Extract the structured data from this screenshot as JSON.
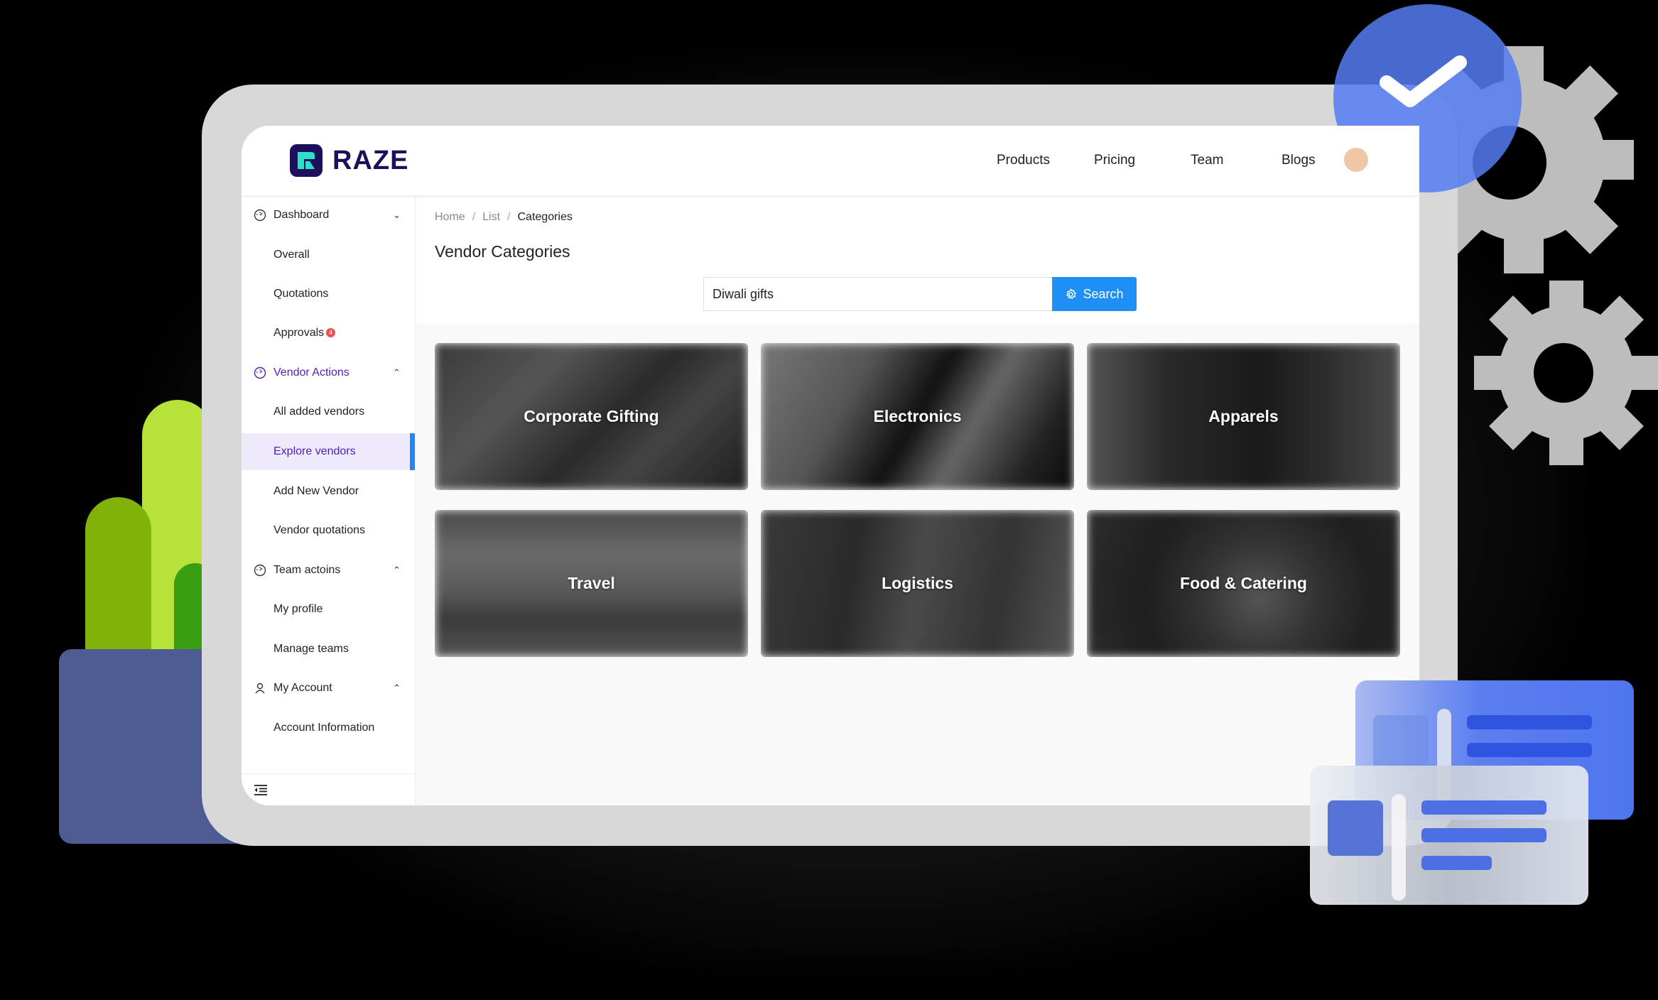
{
  "brand": {
    "name": "RAZE",
    "logo_color": "#1e0f5c",
    "logo_accent": "#2de0c8"
  },
  "nav": {
    "items": [
      {
        "label": "Products"
      },
      {
        "label": "Pricing"
      },
      {
        "label": "Team"
      },
      {
        "label": "Blogs"
      }
    ]
  },
  "sidebar": {
    "items": [
      {
        "label": "Dashboard",
        "type": "group",
        "icon": "gauge-icon",
        "chevron": "down"
      },
      {
        "label": "Overall",
        "type": "sub"
      },
      {
        "label": "Quotations",
        "type": "sub"
      },
      {
        "label": "Approvals",
        "type": "sub",
        "badge": "4"
      },
      {
        "label": "Vendor Actions",
        "type": "group",
        "icon": "gauge-icon",
        "chevron": "up",
        "active_group": true
      },
      {
        "label": "All added vendors",
        "type": "sub"
      },
      {
        "label": "Explore vendors",
        "type": "sub",
        "active": true
      },
      {
        "label": "Add New Vendor",
        "type": "sub"
      },
      {
        "label": "Vendor quotations",
        "type": "sub"
      },
      {
        "label": "Team actoins",
        "type": "group",
        "icon": "gauge-icon",
        "chevron": "up"
      },
      {
        "label": "My profile",
        "type": "sub"
      },
      {
        "label": "Manage teams",
        "type": "sub"
      },
      {
        "label": "My Account",
        "type": "group",
        "icon": "user-icon",
        "chevron": "up"
      },
      {
        "label": "Account Information",
        "type": "sub"
      }
    ],
    "collapse_icon": "menu-collapse-icon"
  },
  "breadcrumb": [
    {
      "label": "Home"
    },
    {
      "label": "List"
    },
    {
      "label": "Categories"
    }
  ],
  "page": {
    "title": "Vendor Categories",
    "search": {
      "value": "Diwali gifts",
      "button_label": "Search",
      "button_icon": "gear-icon"
    }
  },
  "categories": [
    {
      "label": "Corporate Gifting"
    },
    {
      "label": "Electronics"
    },
    {
      "label": "Apparels"
    },
    {
      "label": "Travel"
    },
    {
      "label": "Logistics"
    },
    {
      "label": "Food & Catering"
    }
  ],
  "colors": {
    "accent": "#1e8ff5",
    "active_text": "#4b1fb8",
    "active_bg": "#efe9fc",
    "badge": "#ef4f4f",
    "frame": "#d8d8d8"
  }
}
